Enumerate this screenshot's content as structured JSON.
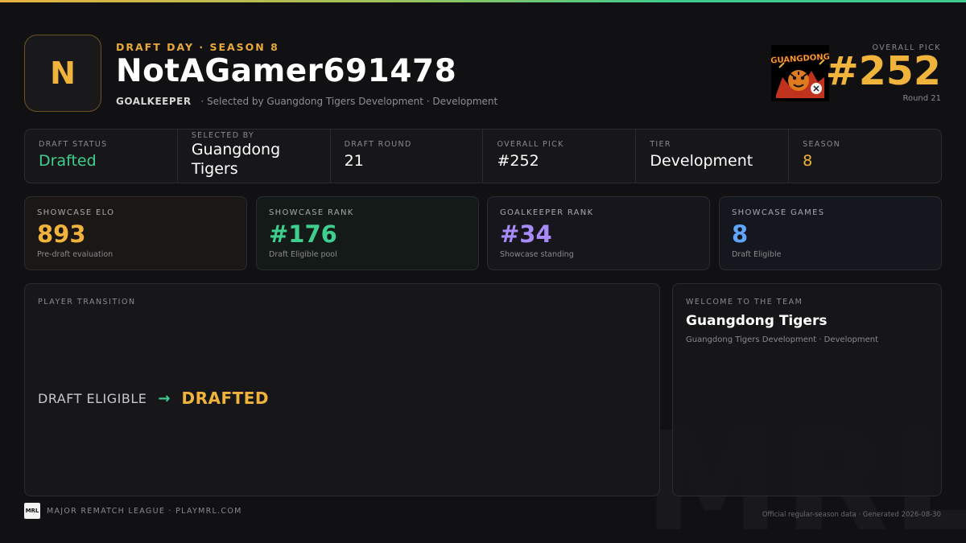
{
  "header": {
    "avatar_letter": "N",
    "eyebrow": "DRAFT DAY · SEASON 8",
    "player_name": "NotAGamer691478",
    "position": "GOALKEEPER",
    "selected_text": "· Selected by Guangdong Tigers Development · Development",
    "team_logo_text": "GUANGDONG",
    "pick_label": "OVERALL PICK",
    "pick_number": "#252",
    "pick_round": "Round 21"
  },
  "info_strip": [
    {
      "label": "DRAFT STATUS",
      "value": "Drafted"
    },
    {
      "label": "SELECTED BY",
      "value": "Guangdong Tigers"
    },
    {
      "label": "DRAFT ROUND",
      "value": "21"
    },
    {
      "label": "OVERALL PICK",
      "value": "#252"
    },
    {
      "label": "TIER",
      "value": "Development"
    },
    {
      "label": "SEASON",
      "value": "8"
    }
  ],
  "stats": [
    {
      "label": "SHOWCASE ELO",
      "value": "893",
      "sub": "Pre-draft evaluation",
      "color": "#f0b43c"
    },
    {
      "label": "SHOWCASE RANK",
      "value": "#176",
      "sub": "Draft Eligible pool",
      "color": "#3ecf8e"
    },
    {
      "label": "GOALKEEPER RANK",
      "value": "#34",
      "sub": "Showcase standing",
      "color": "#a78bfa"
    },
    {
      "label": "SHOWCASE GAMES",
      "value": "8",
      "sub": "Draft Eligible",
      "color": "#60a5fa"
    }
  ],
  "transition": {
    "label": "PLAYER TRANSITION",
    "from": "DRAFT ELIGIBLE",
    "arrow": "→",
    "to": "DRAFTED"
  },
  "welcome": {
    "label": "WELCOME TO THE TEAM",
    "team": "Guangdong Tigers",
    "sub": "Guangdong Tigers Development · Development"
  },
  "footer": {
    "logo_text": "MRL",
    "left_text": "MAJOR REMATCH LEAGUE · PLAYMRL.COM",
    "right_text": "Official regular-season data · Generated 2026-08-30",
    "watermark": "MRL"
  },
  "colors": {
    "accent_gold": "#f0b43c",
    "accent_green": "#3ecf8e",
    "accent_purple": "#a78bfa",
    "accent_blue": "#60a5fa"
  }
}
